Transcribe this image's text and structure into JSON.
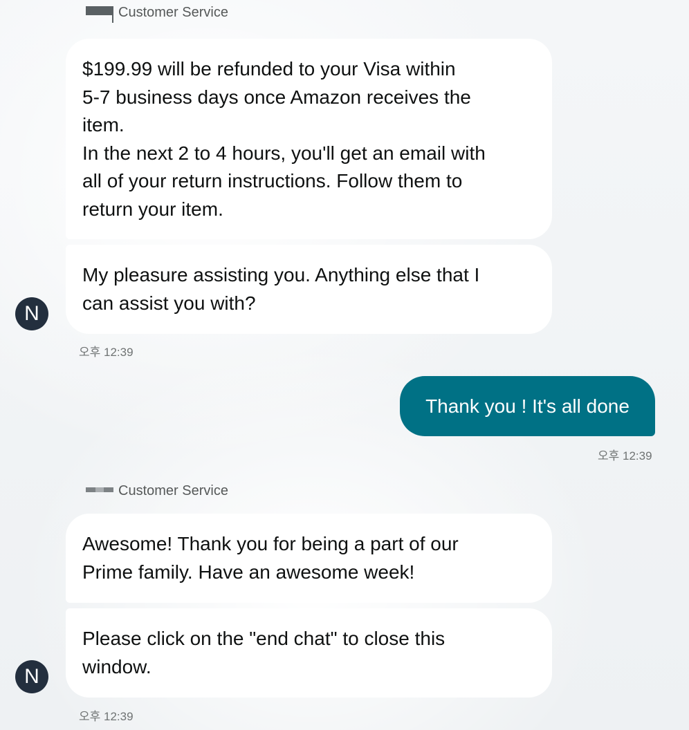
{
  "conversation": [
    {
      "sender": "Customer Service",
      "avatar_letter": "N",
      "messages": [
        "$199.99 will be refunded to your Visa within\n5-7 business days once Amazon receives the\nitem.\nIn the next 2 to 4 hours, you'll get an email with\nall of your return instructions. Follow them to\nreturn your item.",
        "My pleasure assisting you. Anything else that I\ncan assist you with?"
      ],
      "time": "오후 12:39"
    },
    {
      "sender": "user",
      "messages": [
        "Thank you ! It's all done"
      ],
      "time": "오후 12:39"
    },
    {
      "sender": "Customer Service",
      "avatar_letter": "N",
      "messages": [
        "Awesome! Thank you for being a part of our\nPrime family. Have an awesome week!",
        "Please click on the \"end chat\" to close this\nwindow."
      ],
      "time": "오후 12:39"
    }
  ],
  "colors": {
    "user_bubble": "#007185",
    "agent_bubble": "#ffffff",
    "avatar": "#232f3e"
  },
  "icons": {
    "sender_mark": "agent-redacted-logo-icon"
  }
}
